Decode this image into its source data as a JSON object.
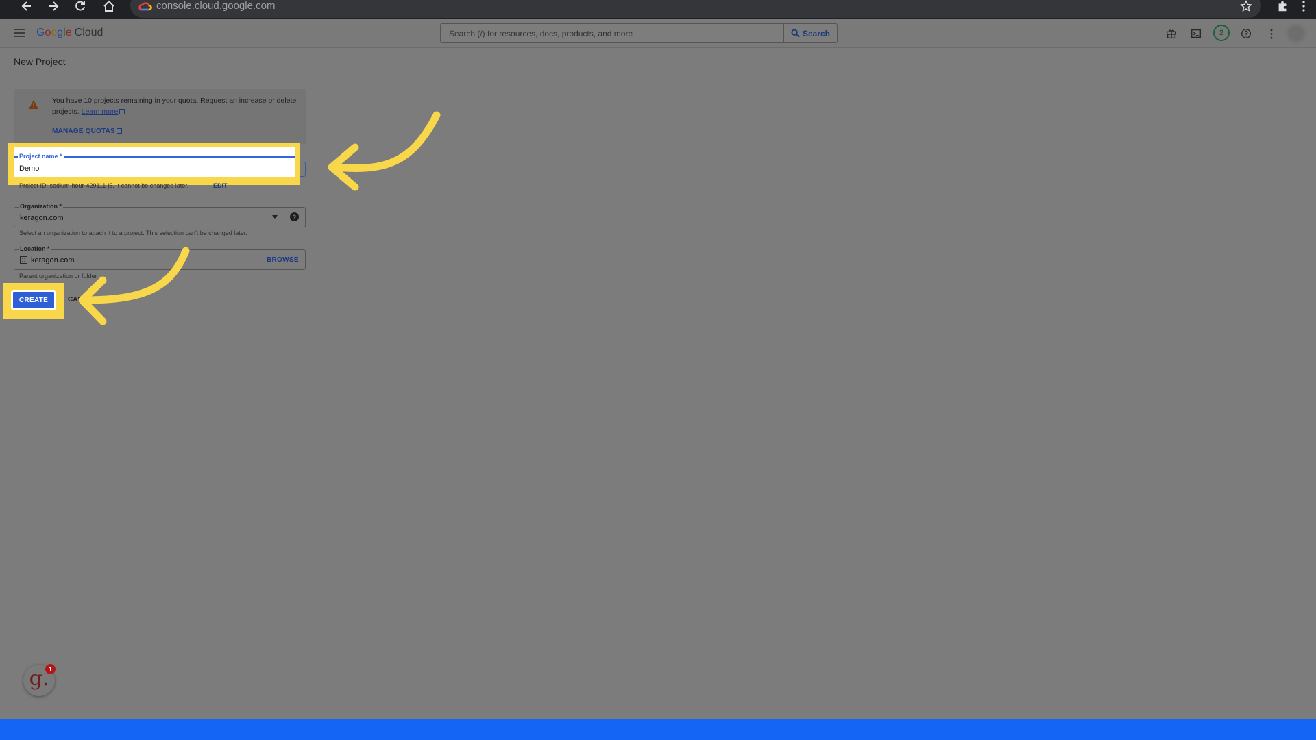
{
  "browser": {
    "url": "console.cloud.google.com"
  },
  "header": {
    "logo_google": [
      "G",
      "o",
      "o",
      "g",
      "l",
      "e"
    ],
    "logo_cloud": "Cloud",
    "search_placeholder": "Search (/) for resources, docs, products, and more",
    "search_button": "Search",
    "notification_count": "2"
  },
  "page": {
    "title": "New Project",
    "quota": {
      "text": "You have 10 projects remaining in your quota. Request an increase or delete projects.",
      "learn_more": "Learn more",
      "manage_quotas": "MANAGE QUOTAS"
    },
    "project_name": {
      "label": "Project name *",
      "value": "Demo",
      "helper": "Project ID: sodium-hour-429111-j5. It cannot be changed later.",
      "edit": "EDIT"
    },
    "organization": {
      "label": "Organization *",
      "value": "keragon.com",
      "helper": "Select an organization to attach it to a project. This selection can't be changed later."
    },
    "location": {
      "label": "Location *",
      "value": "keragon.com",
      "browse": "BROWSE",
      "helper": "Parent organization or folder"
    },
    "create_button": "CREATE",
    "cancel_button": "CANCEL"
  },
  "widget": {
    "glyph": "g.",
    "badge": "1"
  },
  "colors": {
    "highlight": "#f9d74a",
    "primary": "#2f5fd6",
    "bottom_bar": "#1464f5"
  }
}
